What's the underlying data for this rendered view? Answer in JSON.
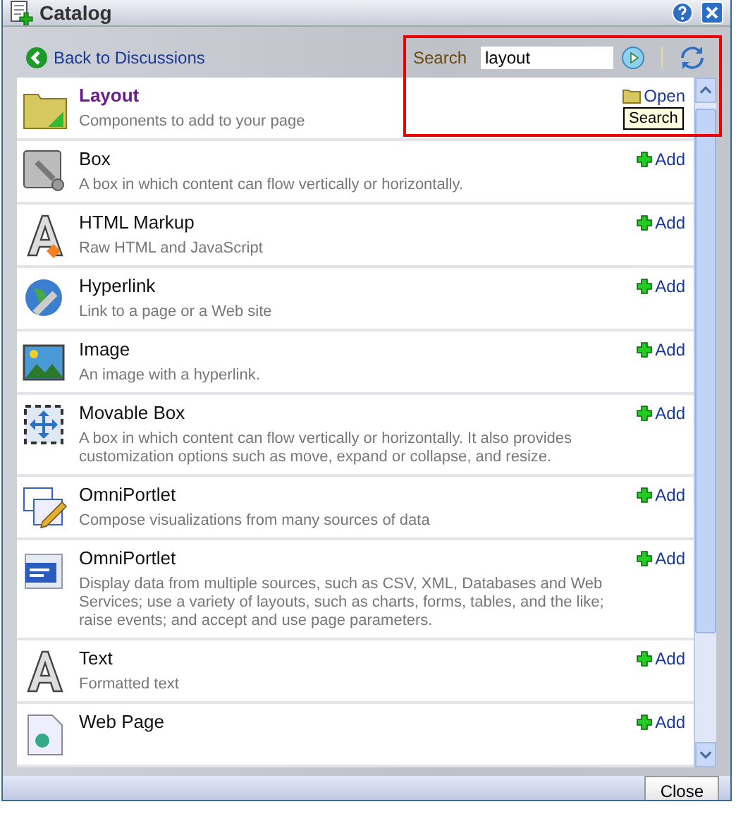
{
  "window": {
    "title": "Catalog"
  },
  "toolbar": {
    "back_link": "Back to Discussions",
    "search_label": "Search",
    "search_value": "layout",
    "tooltip": "Search"
  },
  "items": [
    {
      "kind": "folder",
      "title": "Layout",
      "description": "Components to add to your page",
      "action": "Open"
    },
    {
      "kind": "component",
      "title": "Box",
      "description": "A box in which content can flow vertically or horizontally.",
      "action": "Add"
    },
    {
      "kind": "component",
      "title": "HTML Markup",
      "description": "Raw HTML and JavaScript",
      "action": "Add"
    },
    {
      "kind": "component",
      "title": "Hyperlink",
      "description": "Link to a page or a Web site",
      "action": "Add"
    },
    {
      "kind": "component",
      "title": "Image",
      "description": "An image with a hyperlink.",
      "action": "Add"
    },
    {
      "kind": "component",
      "title": "Movable Box",
      "description": "A box in which content can flow vertically or horizontally. It also provides customization options such as move, expand or collapse, and resize.",
      "action": "Add"
    },
    {
      "kind": "component",
      "title": "OmniPortlet",
      "description": "Compose visualizations from many sources of data",
      "action": "Add"
    },
    {
      "kind": "component",
      "title": "OmniPortlet",
      "description": "Display data from multiple sources, such as CSV, XML, Databases and Web Services; use a variety of layouts, such as charts, forms, tables, and the like; raise events; and accept and use page parameters.",
      "action": "Add"
    },
    {
      "kind": "component",
      "title": "Text",
      "description": "Formatted text",
      "action": "Add"
    },
    {
      "kind": "component",
      "title": "Web Page",
      "action": "Add"
    }
  ],
  "footer": {
    "close_button": "Close"
  }
}
